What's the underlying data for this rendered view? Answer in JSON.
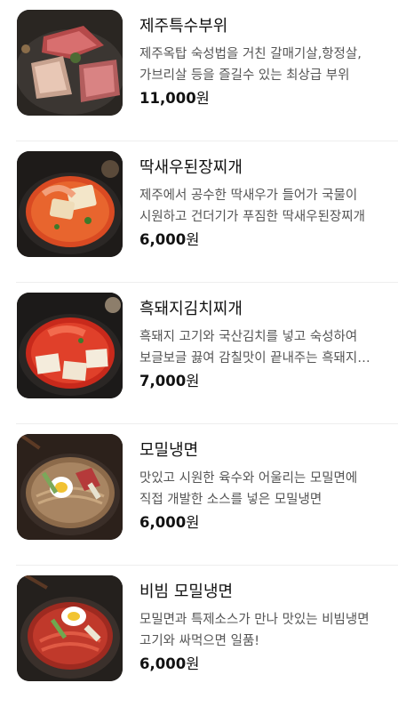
{
  "menu": {
    "items": [
      {
        "name": "제주특수부위",
        "desc": [
          "제주옥탑 숙성법을 거친 갈매기살,항정살,",
          "가브리살 등을 즐길수 있는 최상급 부위"
        ],
        "price": "11,000",
        "unit": "원",
        "image_icon": "grilled-pork-cuts-image"
      },
      {
        "name": "딱새우된장찌개",
        "desc": [
          "제주에서 공수한 딱새우가 들어가 국물이",
          "시원하고 건더기가 푸짐한 딱새우된장찌개"
        ],
        "price": "6,000",
        "unit": "원",
        "image_icon": "shrimp-doenjang-stew-image"
      },
      {
        "name": "흑돼지김치찌개",
        "desc": [
          "흑돼지 고기와 국산김치를 넣고 숙성하여",
          "보글보글 끓여 감칠맛이 끝내주는 흑돼지…"
        ],
        "price": "7,000",
        "unit": "원",
        "image_icon": "kimchi-stew-image"
      },
      {
        "name": "모밀냉면",
        "desc": [
          "맛있고 시원한 육수와 어울리는 모밀면에",
          "직접 개발한 소스를 넣은 모밀냉면"
        ],
        "price": "6,000",
        "unit": "원",
        "image_icon": "cold-buckwheat-noodles-image"
      },
      {
        "name": "비빔 모밀냉면",
        "desc": [
          "모밀면과 특제소스가 만나 맛있는 비빔냉면",
          "고기와 싸먹으면 일품!"
        ],
        "price": "6,000",
        "unit": "원",
        "image_icon": "spicy-buckwheat-noodles-image"
      }
    ]
  }
}
